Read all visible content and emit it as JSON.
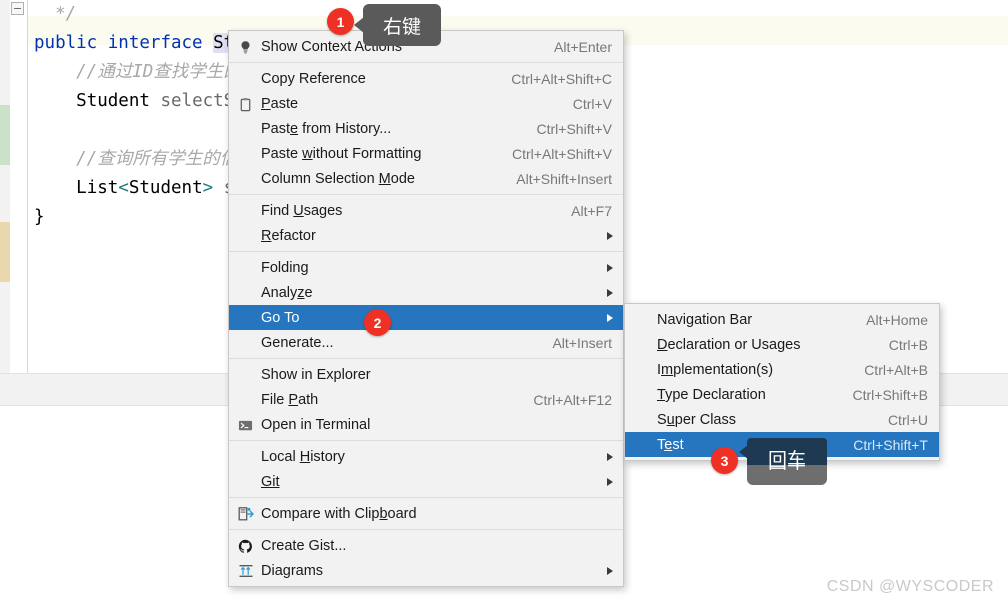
{
  "editor": {
    "fold_icon": "fold-minus-icon",
    "lines": [
      {
        "segments": [
          {
            "text": "  */",
            "cls": "cm"
          }
        ]
      },
      {
        "segments": [
          {
            "text": "public",
            "cls": "kw"
          },
          {
            "text": " ",
            "cls": "id"
          },
          {
            "text": "interface",
            "cls": "kw"
          },
          {
            "text": " ",
            "cls": "id"
          },
          {
            "text": "StudentMapper",
            "cls": "sel"
          }
        ]
      },
      {
        "segments": [
          {
            "text": "    //通过ID查找学生的信息",
            "cls": "cm"
          }
        ]
      },
      {
        "segments": [
          {
            "text": "    ",
            "cls": "id"
          },
          {
            "text": "Student",
            "cls": "tp"
          },
          {
            "text": " ",
            "cls": "id"
          },
          {
            "text": "selectStu",
            "cls": "mt"
          }
        ]
      },
      {
        "segments": [
          {
            "text": "",
            "cls": "id"
          }
        ]
      },
      {
        "segments": [
          {
            "text": "    //查询所有学生的信息",
            "cls": "cm"
          }
        ]
      },
      {
        "segments": [
          {
            "text": "    ",
            "cls": "id"
          },
          {
            "text": "List",
            "cls": "tp"
          },
          {
            "text": "<",
            "cls": "gen"
          },
          {
            "text": "Student",
            "cls": "tp"
          },
          {
            "text": ">",
            "cls": "gen"
          },
          {
            "text": " ",
            "cls": "id"
          },
          {
            "text": "sel",
            "cls": "mt"
          }
        ]
      },
      {
        "segments": [
          {
            "text": "}",
            "cls": "id"
          }
        ]
      }
    ]
  },
  "context_menu": {
    "items": [
      {
        "label": "Show Context Actions",
        "shortcut": "Alt+Enter",
        "icon": "lightbulb-icon",
        "submenu": false,
        "selected": false
      },
      {
        "separator": true
      },
      {
        "label": "Copy Reference",
        "shortcut": "Ctrl+Alt+Shift+C",
        "icon": "",
        "submenu": false,
        "selected": false
      },
      {
        "label": "Paste",
        "label_html": "<u>P</u>aste",
        "shortcut": "Ctrl+V",
        "icon": "clipboard-icon",
        "submenu": false,
        "selected": false
      },
      {
        "label": "Paste from History...",
        "label_html": "Past<u>e</u> from History...",
        "shortcut": "Ctrl+Shift+V",
        "icon": "",
        "submenu": false,
        "selected": false
      },
      {
        "label": "Paste without Formatting",
        "label_html": "Paste <u>w</u>ithout Formatting",
        "shortcut": "Ctrl+Alt+Shift+V",
        "icon": "",
        "submenu": false,
        "selected": false
      },
      {
        "label": "Column Selection Mode",
        "label_html": "Column Selection <u>M</u>ode",
        "shortcut": "Alt+Shift+Insert",
        "icon": "",
        "submenu": false,
        "selected": false
      },
      {
        "separator": true
      },
      {
        "label": "Find Usages",
        "label_html": "Find <u>U</u>sages",
        "shortcut": "Alt+F7",
        "icon": "",
        "submenu": false,
        "selected": false
      },
      {
        "label": "Refactor",
        "label_html": "<u>R</u>efactor",
        "shortcut": "",
        "icon": "",
        "submenu": true,
        "selected": false
      },
      {
        "separator": true
      },
      {
        "label": "Folding",
        "shortcut": "",
        "icon": "",
        "submenu": true,
        "selected": false
      },
      {
        "label": "Analyze",
        "label_html": "Analy<u>z</u>e",
        "shortcut": "",
        "icon": "",
        "submenu": true,
        "selected": false
      },
      {
        "label": "Go To",
        "shortcut": "",
        "icon": "",
        "submenu": true,
        "selected": true
      },
      {
        "label": "Generate...",
        "shortcut": "Alt+Insert",
        "icon": "",
        "submenu": false,
        "selected": false
      },
      {
        "separator": true
      },
      {
        "label": "Show in Explorer",
        "shortcut": "",
        "icon": "",
        "submenu": false,
        "selected": false
      },
      {
        "label": "File Path",
        "label_html": "File <u>P</u>ath",
        "shortcut": "Ctrl+Alt+F12",
        "icon": "",
        "submenu": false,
        "selected": false
      },
      {
        "label": "Open in Terminal",
        "shortcut": "",
        "icon": "terminal-icon",
        "submenu": false,
        "selected": false
      },
      {
        "separator": true
      },
      {
        "label": "Local History",
        "label_html": "Local <u>H</u>istory",
        "shortcut": "",
        "icon": "",
        "submenu": true,
        "selected": false
      },
      {
        "label": "Git",
        "label_html": "<u>Git</u>",
        "shortcut": "",
        "icon": "",
        "submenu": true,
        "selected": false
      },
      {
        "separator": true
      },
      {
        "label": "Compare with Clipboard",
        "label_html": "Compare with Clip<u>b</u>oard",
        "shortcut": "",
        "icon": "compare-icon",
        "submenu": false,
        "selected": false
      },
      {
        "separator": true
      },
      {
        "label": "Create Gist...",
        "shortcut": "",
        "icon": "github-icon",
        "submenu": false,
        "selected": false
      },
      {
        "label": "Diagrams",
        "shortcut": "",
        "icon": "diagram-icon",
        "submenu": true,
        "selected": false
      }
    ]
  },
  "submenu_goto": {
    "items": [
      {
        "label": "Navigation Bar",
        "shortcut": "Alt+Home",
        "selected": false
      },
      {
        "label": "Declaration or Usages",
        "label_html": "<u>D</u>eclaration or Usages",
        "shortcut": "Ctrl+B",
        "selected": false
      },
      {
        "label": "Implementation(s)",
        "label_html": "I<u>m</u>plementation(s)",
        "shortcut": "Ctrl+Alt+B",
        "selected": false
      },
      {
        "label": "Type Declaration",
        "label_html": "<u>T</u>ype Declaration",
        "shortcut": "Ctrl+Shift+B",
        "selected": false
      },
      {
        "label": "Super Class",
        "label_html": "S<u>u</u>per Class",
        "shortcut": "Ctrl+U",
        "selected": false
      },
      {
        "label": "Test",
        "label_html": "T<u>e</u>st",
        "shortcut": "Ctrl+Shift+T",
        "selected": true
      }
    ]
  },
  "annotations": {
    "badges": [
      {
        "number": "1"
      },
      {
        "number": "2"
      },
      {
        "number": "3"
      }
    ],
    "tooltips": [
      {
        "text": "右键"
      },
      {
        "text": "回车"
      }
    ]
  },
  "watermark": {
    "text": "CSDN @WYSCODER"
  },
  "colors": {
    "accent_selected": "#2675bf",
    "badge_red": "#ee3124",
    "menu_bg": "#f2f2f2",
    "keyword_blue": "#0033b3",
    "comment_gray": "#a8a8a8"
  }
}
